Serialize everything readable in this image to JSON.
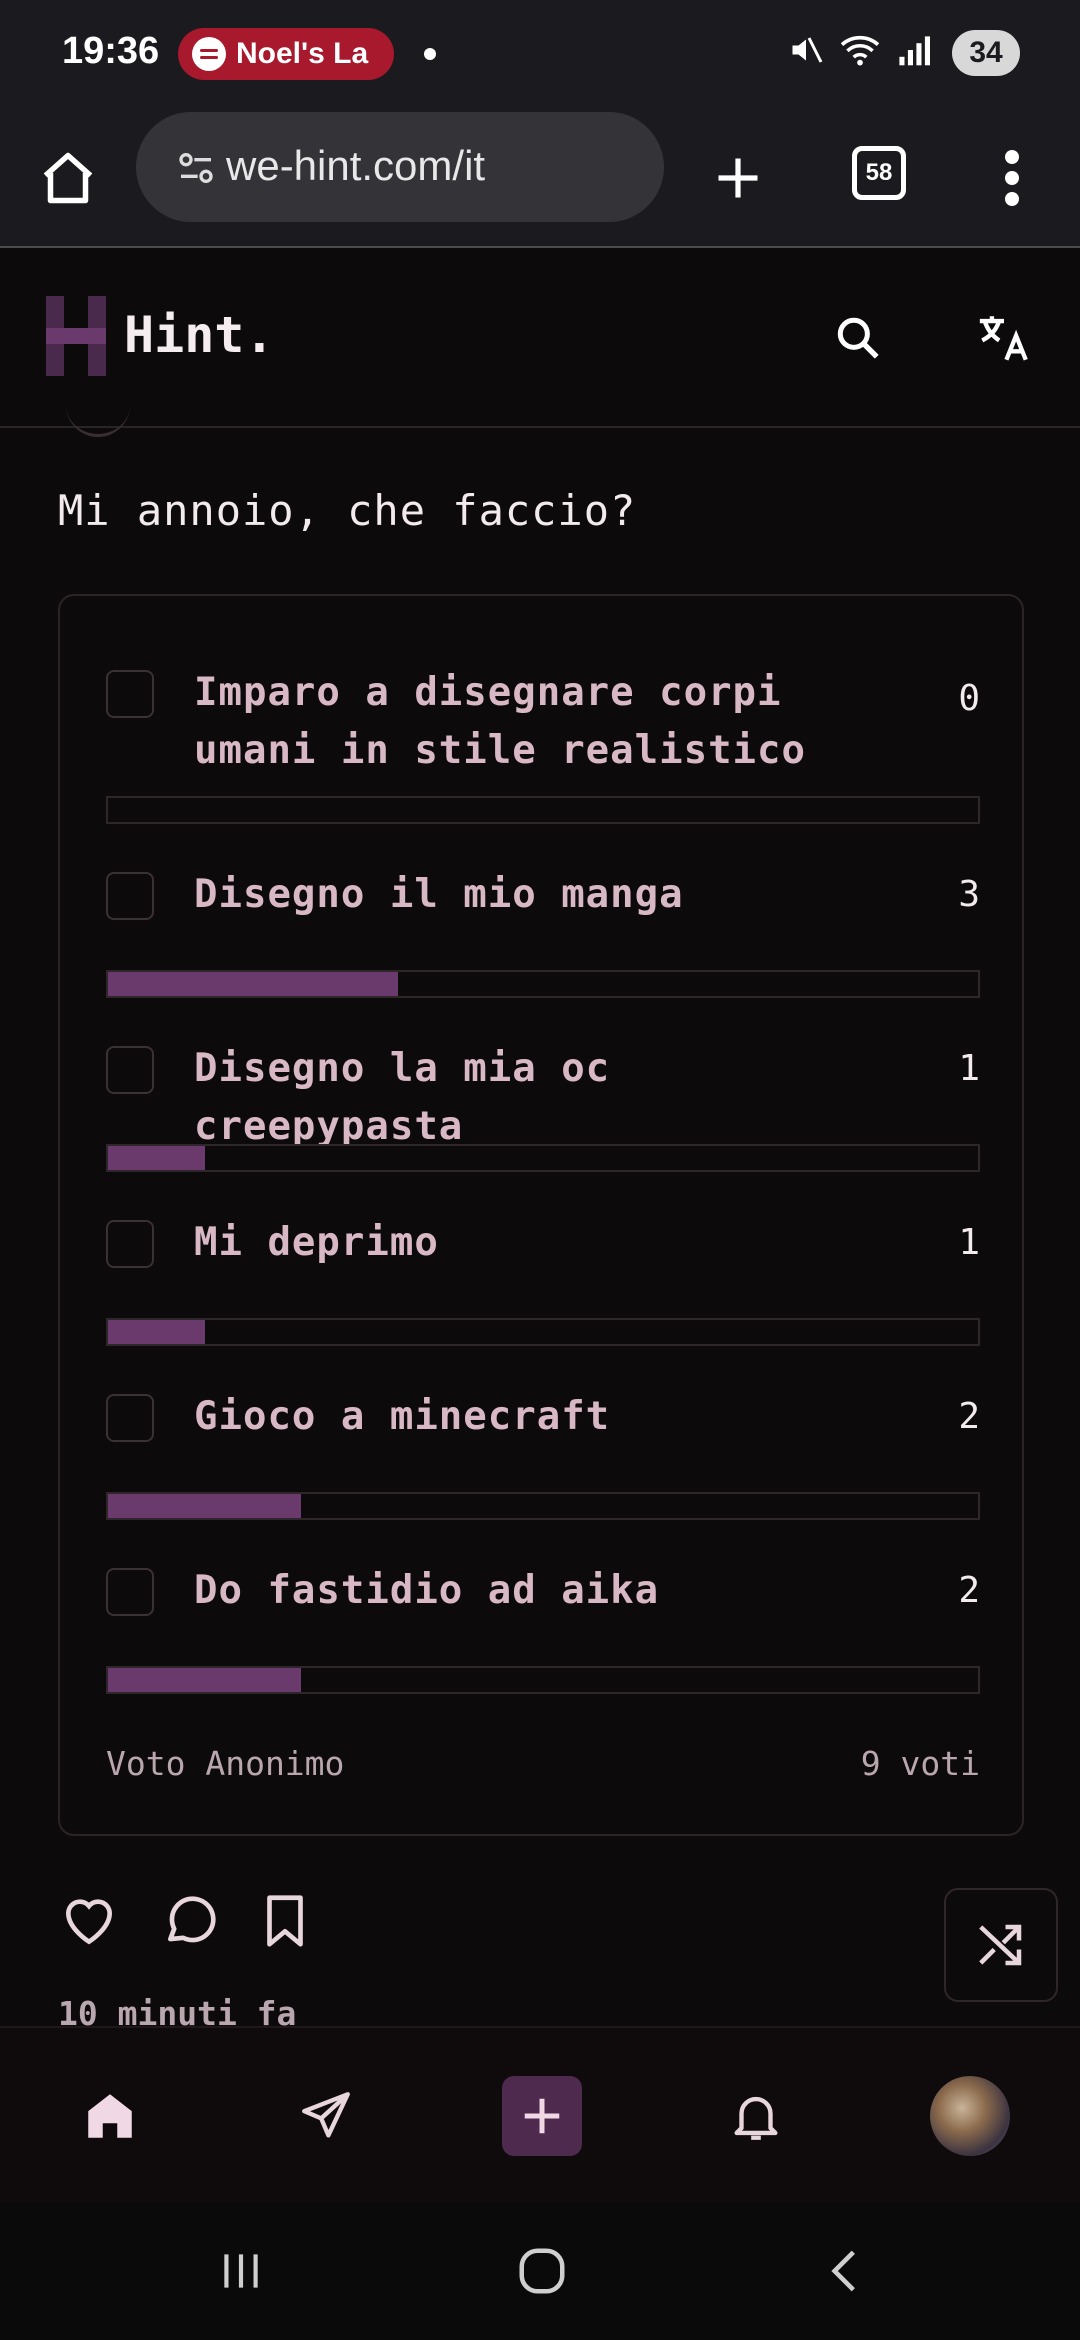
{
  "status_bar": {
    "time": "19:36",
    "media_pill": "Noel's La",
    "battery": "34"
  },
  "browser": {
    "url": "we-hint.com/it",
    "tab_count": "58"
  },
  "app": {
    "brand": "Hint."
  },
  "post": {
    "question": "Mi annoio, che faccio?",
    "poll": {
      "options": [
        {
          "label": "Imparo a disegnare corpi umani in stile realistico",
          "count": "0",
          "fraction": 0.0
        },
        {
          "label": "Disegno il mio manga",
          "count": "3",
          "fraction": 0.333
        },
        {
          "label": "Disegno la mia oc creepypasta",
          "count": "1",
          "fraction": 0.111
        },
        {
          "label": "Mi deprimo",
          "count": "1",
          "fraction": 0.111
        },
        {
          "label": "Gioco a minecraft",
          "count": "2",
          "fraction": 0.222
        },
        {
          "label": "Do fastidio ad aika",
          "count": "2",
          "fraction": 0.222
        }
      ],
      "anonymous_label": "Voto Anonimo",
      "total_votes": "9 voti"
    },
    "time_ago": "10 minuti fa"
  },
  "colors": {
    "accent": "#6a3a6c",
    "background": "#0d0a0c",
    "option_text": "#d8b8c4"
  }
}
